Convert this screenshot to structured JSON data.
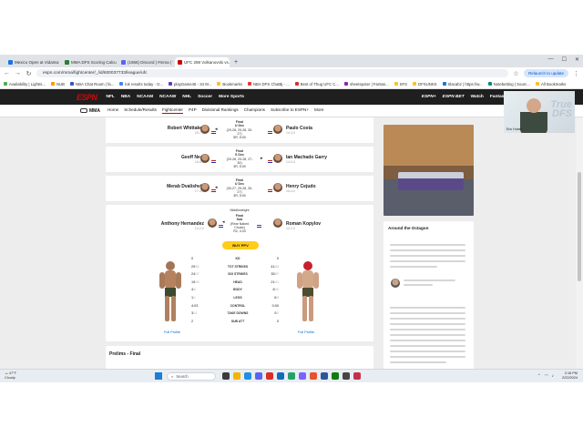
{
  "browser": {
    "tabs": [
      {
        "label": "Mexico Open at Vidanta: Mat",
        "color": "#1a73e8",
        "active": false
      },
      {
        "label": "MMA DFS Scoring Calculator",
        "color": "#2e7d32",
        "active": false
      },
      {
        "label": "(1966) Discord | #mma | TheU",
        "color": "#5865f2",
        "active": false
      },
      {
        "label": "UFC 298 Volkanovski vs. Topu",
        "color": "#cc0000",
        "active": true
      }
    ],
    "url": "espn.com/mma/fightcenter/_/id/600037733/league/ufc",
    "relaunch_label": "Relaunch to update",
    "bookmarks": [
      {
        "label": "Availability | Lightni...",
        "color": "#4caf50"
      },
      {
        "label": "NUB",
        "color": "#ff9800"
      },
      {
        "label": "NBA Chat Room | fa...",
        "color": "#3f51b5"
      },
      {
        "label": "lok results today - G...",
        "color": "#4285f4"
      },
      {
        "label": "playGame45 - 34 M...",
        "color": "#673ab7"
      },
      {
        "label": "Bookmarks",
        "color": "#fbc02d"
      },
      {
        "label": "NBA DFS ChatBj - ...",
        "color": "#e53935"
      },
      {
        "label": "Best of Thug UFC C...",
        "color": "#d32f2f"
      },
      {
        "label": "sheetspoter | Fantas...",
        "color": "#8e24aa"
      },
      {
        "label": "SFS",
        "color": "#fbc02d"
      },
      {
        "label": "DFSUNKS",
        "color": "#fbc02d"
      },
      {
        "label": "Slacabz | https://w...",
        "color": "#1976d2"
      },
      {
        "label": "Notebetting | Sourc...",
        "color": "#00897b"
      },
      {
        "label": "All Bookmarks",
        "color": "#fbc02d"
      }
    ]
  },
  "espn": {
    "logo": "ESPN",
    "sports_nav": [
      "NFL",
      "NBA",
      "NCAAM",
      "NCAAW",
      "NHL",
      "Soccer",
      "More Sports"
    ],
    "right_nav": [
      "ESPN+",
      "ESPN BET",
      "Watch",
      "Fantasy"
    ],
    "sub_nav_title": "MMA",
    "sub_nav": [
      "Home",
      "Schedule/Results",
      "Fightcenter",
      "P4P",
      "Divisional Rankings",
      "Champions",
      "Subscribe to ESPN+",
      "More"
    ],
    "sub_nav_active": 2
  },
  "fights": [
    {
      "left": "Robert Whittaker",
      "left_rec": "25-7-0",
      "right": "Paulo Costa",
      "right_rec": "14-3-0",
      "result": "Final",
      "method": "U Dec",
      "detail": "(29-28, 29-28, 30-27)",
      "time": "5R, 5:00",
      "winner": "left"
    },
    {
      "left": "Geoff Neal",
      "left_rec": "16-6-0",
      "right": "Ian Machado Garry",
      "right_rec": "14-0-0",
      "result": "Final",
      "method": "S Dec",
      "detail": "(29-28, 29-28, 27-30)",
      "time": "3R, 5:00",
      "winner": "right"
    },
    {
      "left": "Merab Dvalishvili",
      "left_rec": "17-4-0",
      "right": "Henry Cejudo",
      "right_rec": "16-4-0",
      "result": "Final",
      "method": "U Dec",
      "detail": "(30-27, 29-28, 30-27)",
      "time": "3R, 5:00",
      "winner": "left"
    }
  ],
  "featured": {
    "division": "Middleweight",
    "left": "Anthony Hernandez",
    "left_rec": "12-2-0",
    "right": "Roman Kopylov",
    "right_rec": "12-2-0",
    "result": "Final",
    "method": "Sub",
    "detail": "(Rear Naked Choke)",
    "time": "R2, 4:33",
    "winner": "left",
    "buy_label": "BUY PPV",
    "stats": [
      {
        "label": "KD",
        "left": "0",
        "right": "0"
      },
      {
        "label": "TOT STRIKES",
        "left": "29",
        "left_of": "/52",
        "right": "41",
        "right_of": "/63"
      },
      {
        "label": "SIG STRIKES",
        "left": "24",
        "left_of": "/47",
        "right": "35",
        "right_of": "/57"
      },
      {
        "label": "HEAD",
        "left": "19",
        "left_of": "/40",
        "right": "21",
        "right_of": "/41"
      },
      {
        "label": "BODY",
        "left": "4",
        "left_of": "/6",
        "right": "8",
        "right_of": "/10"
      },
      {
        "label": "LEGS",
        "left": "1",
        "left_of": "/1",
        "right": "6",
        "right_of": "/6"
      },
      {
        "label": "CONTROL",
        "left": "4:03",
        "right": "0:00"
      },
      {
        "label": "TAKE DOWNS",
        "left": "3",
        "left_of": "/11",
        "right": "0",
        "right_of": "/0"
      },
      {
        "label": "SUB ATT",
        "left": "2",
        "right": "0"
      }
    ],
    "full_profile": "Full Profile"
  },
  "prelims_title": "Prelims - Final",
  "sidebar": {
    "title": "Around the Octagon"
  },
  "webcam": {
    "watermark_1": "True",
    "watermark_2": "DFS",
    "name": "Eric Huber"
  },
  "taskbar": {
    "weather_temp": "47°F",
    "weather_text": "Cloudy",
    "search_placeholder": "Search",
    "time": "2:16 PM",
    "date": "2/22/2024"
  }
}
